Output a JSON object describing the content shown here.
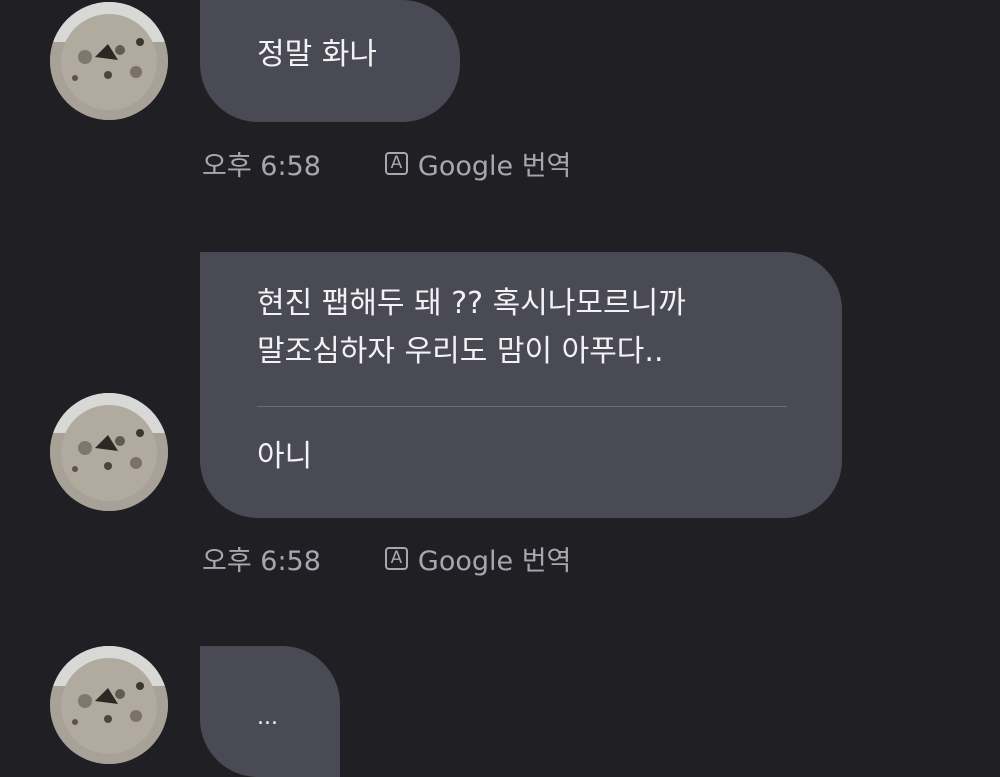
{
  "messages": [
    {
      "text": "정말 화나",
      "time": "오후 6:58",
      "translate_label": "Google 번역",
      "translate_icon": "A"
    },
    {
      "lines": [
        "현진 팹해두 돼 ?? 혹시나모르니까",
        "말조심하자 우리도 맘이 아푸다.."
      ],
      "reply": "아니",
      "time": "오후 6:58",
      "translate_label": "Google 번역",
      "translate_icon": "A"
    },
    {
      "text": "..."
    }
  ],
  "colors": {
    "background": "#202024",
    "bubble": "#4a4a54",
    "text": "#f2f1f5",
    "meta_text": "#a8a7b0"
  }
}
